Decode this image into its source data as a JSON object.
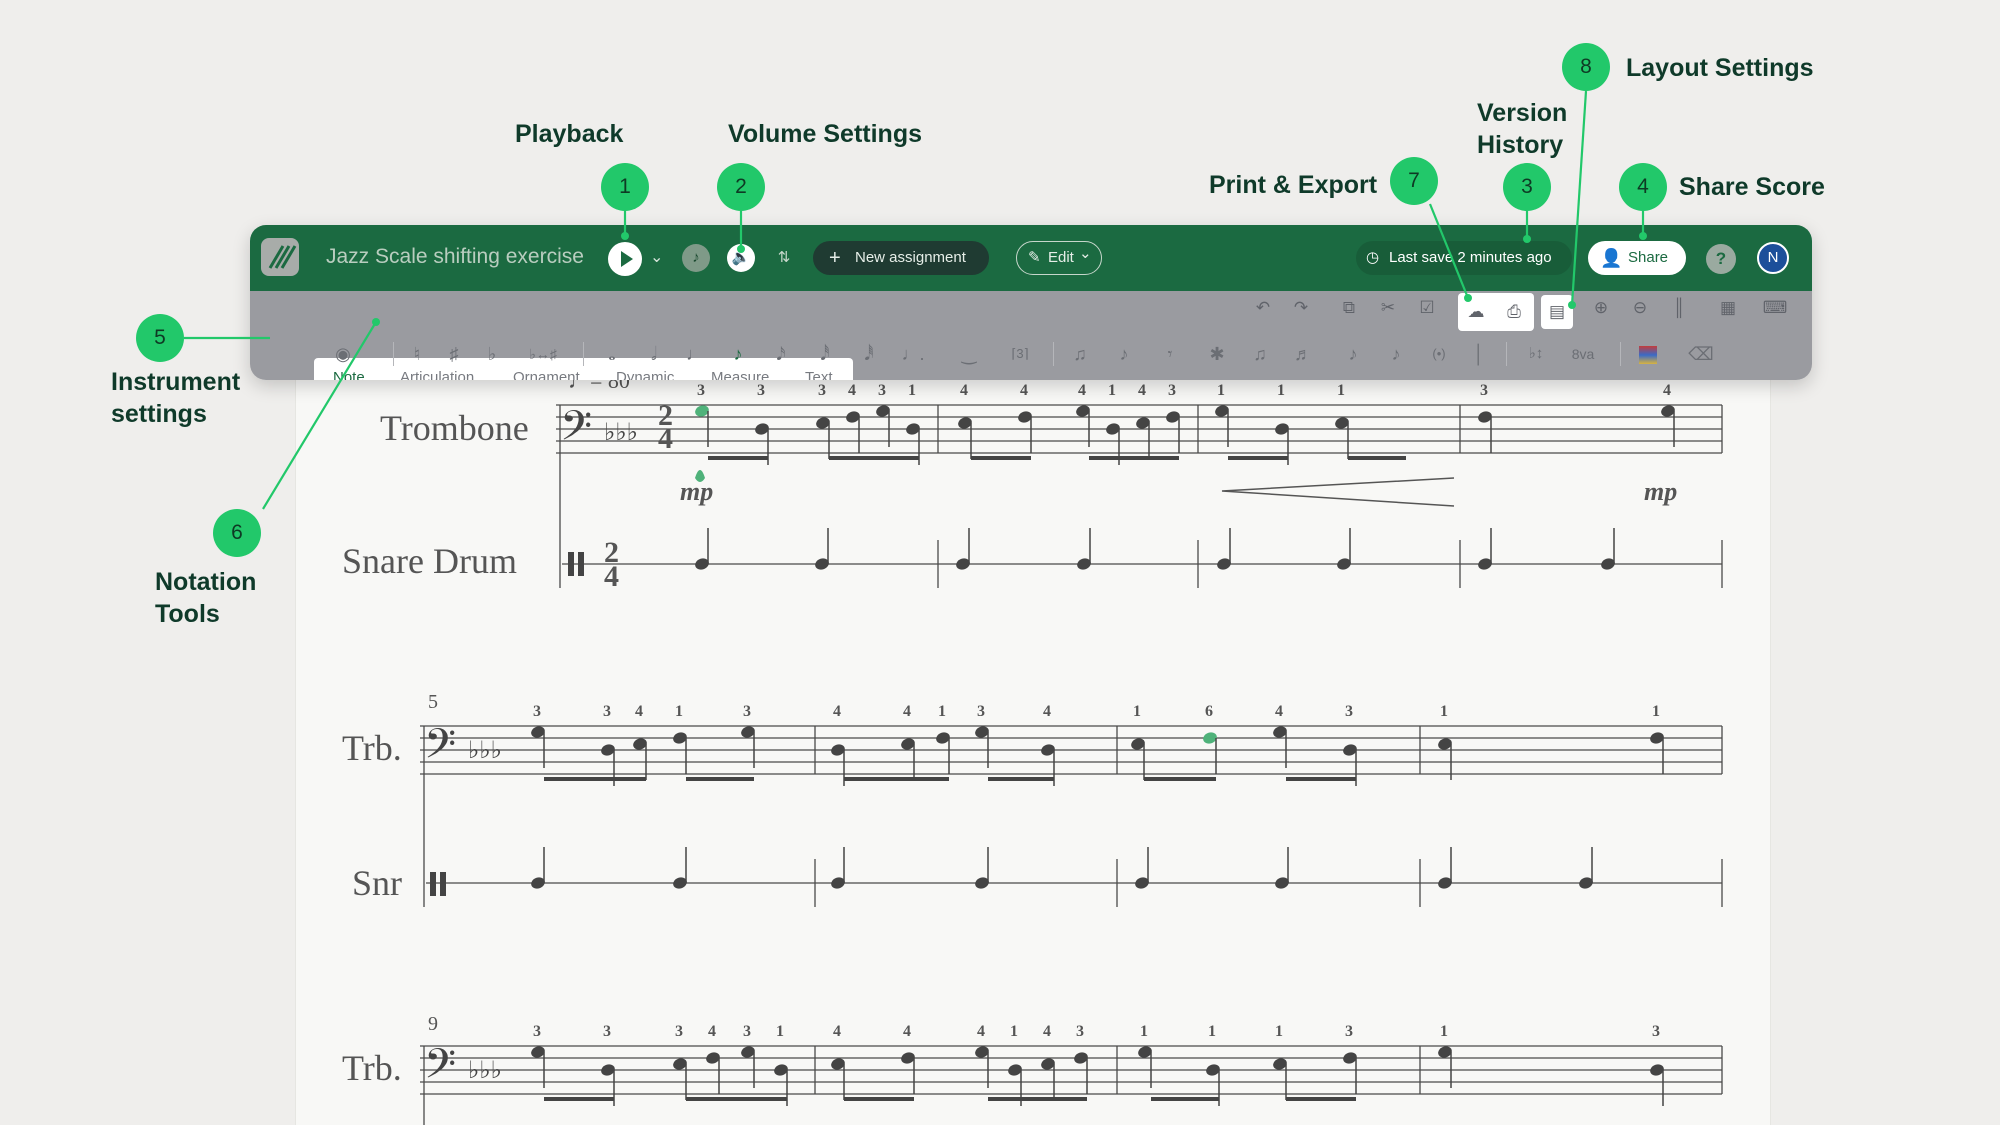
{
  "app": {
    "score_title": "Jazz Scale shifting exercise",
    "new_assignment": "New assignment",
    "edit": "Edit",
    "last_save": "Last save 2 minutes ago",
    "share": "Share",
    "help": "?",
    "avatar_initial": "N"
  },
  "tabs": [
    "Note",
    "Articulation",
    "Ornament",
    "Dynamic",
    "Measure",
    "Text"
  ],
  "callouts": {
    "playback": {
      "num": "1",
      "label": "Playback"
    },
    "volume": {
      "num": "2",
      "label": "Volume Settings"
    },
    "version": {
      "num": "3",
      "label": "Version\nHistory"
    },
    "share": {
      "num": "4",
      "label": "Share Score"
    },
    "instrument": {
      "num": "5",
      "label": "Instrument\nsettings"
    },
    "notation": {
      "num": "6",
      "label": "Notation\nTools"
    },
    "export": {
      "num": "7",
      "label": "Print & Export"
    },
    "layout": {
      "num": "8",
      "label": "Layout Settings"
    }
  },
  "score": {
    "tempo_partial": "♩= 80",
    "trombone": "Trombone",
    "snare": "Snare Drum",
    "trb": "Trb.",
    "snr": "Snr",
    "dynamic_mp": "mp",
    "measure_5": "5",
    "measure_9": "9",
    "octave_mark": "8va",
    "time_top": "2",
    "time_bottom": "4",
    "fingerings": {
      "sys1": [
        "3",
        "3",
        "3",
        "4",
        "3",
        "1",
        "4",
        "4",
        "4",
        "1",
        "4",
        "3",
        "1",
        "1",
        "1",
        "3",
        "4"
      ],
      "sys2": [
        "3",
        "3",
        "4",
        "1",
        "3",
        "4",
        "4",
        "1",
        "3",
        "4",
        "1",
        "6",
        "4",
        "3",
        "1",
        "1"
      ],
      "sys3": [
        "3",
        "3",
        "3",
        "4",
        "3",
        "1",
        "4",
        "4",
        "4",
        "1",
        "4",
        "3",
        "1",
        "1",
        "1",
        "3",
        "1",
        "3"
      ]
    }
  },
  "colors": {
    "brand_green": "#1b6a41",
    "callout_green": "#22c86a",
    "toolbar_gray": "#9a9ba0"
  },
  "icons": [
    "logo-icon",
    "play-icon",
    "chevron-down-icon",
    "metronome-icon",
    "volume-icon",
    "mixer-icon",
    "plus-icon",
    "pencil-icon",
    "clock-icon",
    "add-user-icon",
    "help-icon",
    "piano-icon",
    "undo-icon",
    "redo-icon",
    "copy-icon",
    "scissors-icon",
    "paste-icon",
    "cloud-download-icon",
    "print-icon",
    "layout-icon",
    "zoom-in-icon",
    "zoom-out-icon",
    "barlines-icon",
    "keyboard-icon",
    "palette-icon",
    "delete-icon"
  ]
}
